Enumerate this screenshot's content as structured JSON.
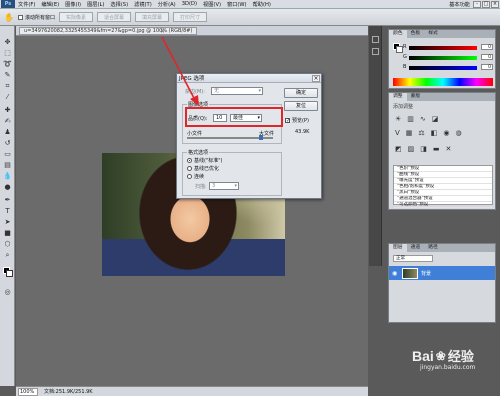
{
  "menubar": {
    "app_logo": "Ps",
    "items": [
      "文件(F)",
      "编辑(E)",
      "图像(I)",
      "图层(L)",
      "选择(S)",
      "滤镜(T)",
      "分析(A)",
      "3D(D)",
      "视图(V)",
      "窗口(W)",
      "帮助(H)"
    ],
    "workspace": "基本功能",
    "window_buttons": [
      "-",
      "□",
      "×"
    ]
  },
  "optionsbar": {
    "checkbox_label": "滚动所有窗口",
    "buttons": [
      "实际像素",
      "适合屏幕",
      "填充屏幕",
      "打印尺寸"
    ]
  },
  "document": {
    "tab_title": "u=3497620082,3325455349&fm=27&gp=0.jpg @ 100% (RGB/8#)",
    "zoom": "100%",
    "doc_info": "文档:251.9K/251.9K"
  },
  "dialog": {
    "title": "JPEG 选项",
    "matte_label": "杂边(M):",
    "matte_value": "无",
    "image_options_label": "图像选项",
    "quality_label": "品质(Q):",
    "quality_value": "10",
    "quality_preset": "最佳",
    "small_file": "小文件",
    "large_file": "大文件",
    "format_options_label": "格式选项",
    "format_baseline_std": "基线(\"标准\")",
    "format_baseline_opt": "基线已优化",
    "format_progressive": "连续",
    "scans_label": "扫描:",
    "scans_value": "3",
    "ok": "确定",
    "reset": "复位",
    "preview_label": "预览(P)",
    "preview_checked": true,
    "file_size": "43.9K"
  },
  "panels": {
    "color_tabs": [
      "颜色",
      "色板",
      "样式"
    ],
    "channel_labels": [
      "R",
      "G",
      "B"
    ],
    "channel_values": [
      "0",
      "0",
      "0"
    ],
    "adjustments_tabs": [
      "调整",
      "蒙版"
    ],
    "adjustments_title": "添加调整",
    "presets": [
      "\"色阶\"预设",
      "\"曲线\"预设",
      "\"曝光度\"预设",
      "\"色相/饱和度\"预设",
      "\"黑白\"预设",
      "\"通道混合器\"预设",
      "\"可选颜色\"预设"
    ],
    "layers_tabs": [
      "图层",
      "通道",
      "路径"
    ],
    "blend_mode": "正常",
    "layer_name": "背景"
  },
  "watermark": {
    "brand": "Bai",
    "brand_sub": "经验",
    "url": "jingyan.baidu.com"
  },
  "colors": {
    "highlight": "#e0262a",
    "layer_selected": "#3f7fd8"
  }
}
